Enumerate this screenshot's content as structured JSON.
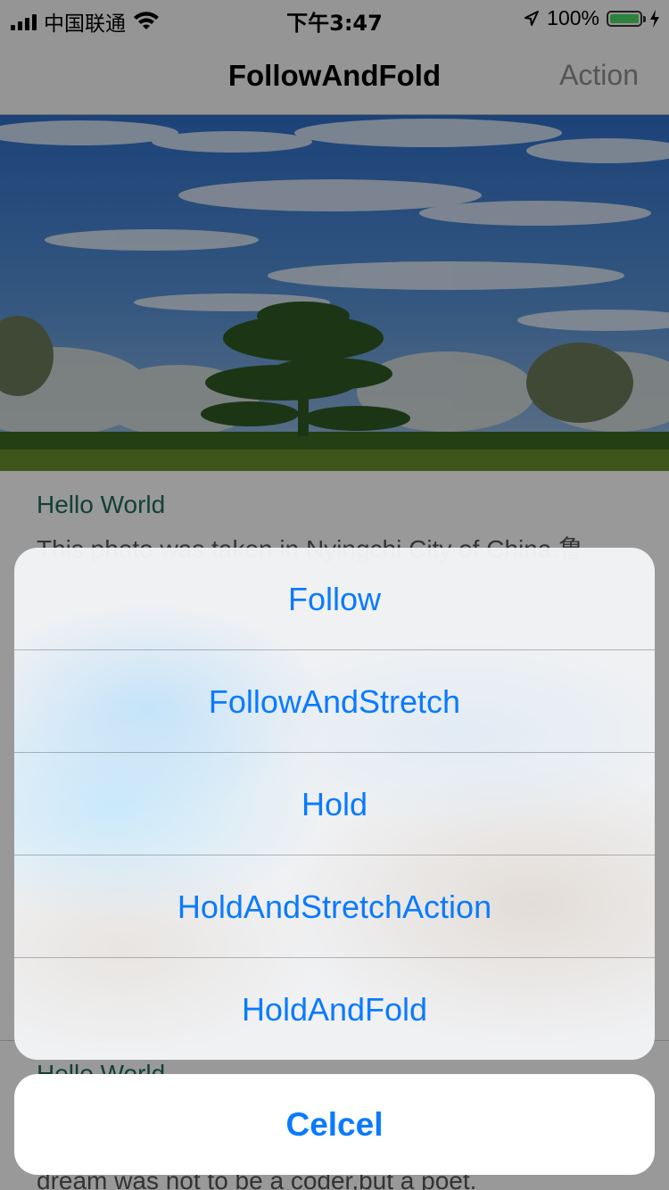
{
  "status_bar": {
    "carrier": "中国联通",
    "time": "下午3:47",
    "battery_percent_text": "100%",
    "battery_level": 1.0,
    "battery_color": "#4cd964"
  },
  "nav": {
    "title": "FollowAndFold",
    "action_label": "Action"
  },
  "content": {
    "sections": [
      {
        "title": "Hello World",
        "body": "This photo was taken in Nyingchi City of China.鲁"
      },
      {
        "title": "Hello World",
        "body": "dream was not to be a coder,but a poet."
      }
    ]
  },
  "action_sheet": {
    "items": [
      {
        "label": "Follow"
      },
      {
        "label": "FollowAndStretch"
      },
      {
        "label": "Hold"
      },
      {
        "label": "HoldAndStretchAction"
      },
      {
        "label": "HoldAndFold"
      }
    ],
    "cancel_label": "Celcel",
    "accent_color": "#0a7aff"
  },
  "icons": {
    "signal": "signal-bars-icon",
    "wifi": "wifi-icon",
    "location": "location-arrow-icon",
    "battery": "battery-icon",
    "charging": "charging-bolt-icon"
  }
}
